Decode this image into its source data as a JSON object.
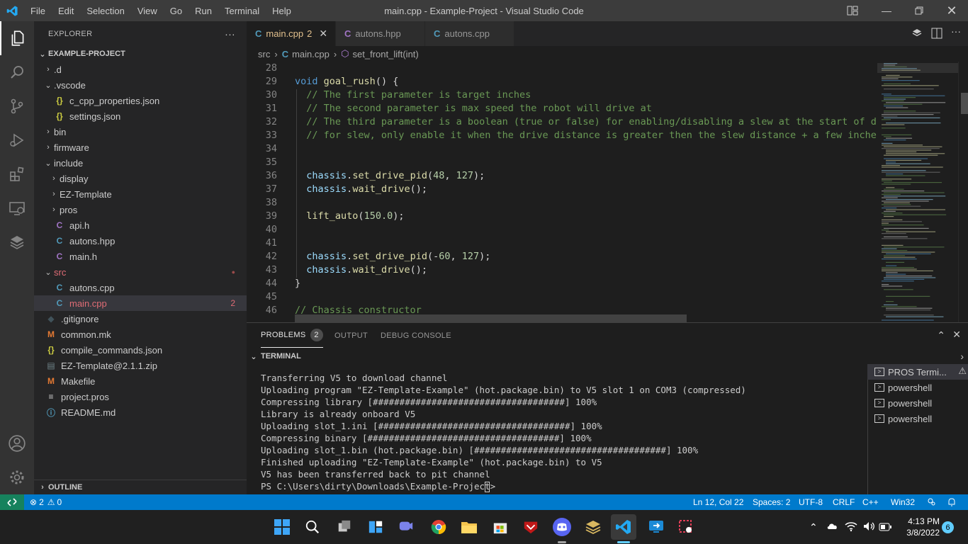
{
  "titlebar": {
    "menu": [
      "File",
      "Edit",
      "Selection",
      "View",
      "Go",
      "Run",
      "Terminal",
      "Help"
    ],
    "title": "main.cpp - Example-Project - Visual Studio Code"
  },
  "sidebar": {
    "header": "EXPLORER",
    "more": "···",
    "project": "EXAMPLE-PROJECT",
    "outline": "OUTLINE",
    "tree": [
      {
        "label": ".d",
        "kind": "folder-closed"
      },
      {
        "label": ".vscode",
        "kind": "folder-open"
      },
      {
        "label": "c_cpp_properties.json",
        "kind": "json"
      },
      {
        "label": "settings.json",
        "kind": "json"
      },
      {
        "label": "bin",
        "kind": "folder-closed"
      },
      {
        "label": "firmware",
        "kind": "folder-closed"
      },
      {
        "label": "include",
        "kind": "folder-open"
      },
      {
        "label": "display",
        "kind": "folder-closed"
      },
      {
        "label": "EZ-Template",
        "kind": "folder-closed"
      },
      {
        "label": "pros",
        "kind": "folder-closed"
      },
      {
        "label": "api.h",
        "kind": "c-header"
      },
      {
        "label": "autons.hpp",
        "kind": "cpp"
      },
      {
        "label": "main.h",
        "kind": "c-header"
      },
      {
        "label": "src",
        "kind": "folder-open-modified"
      },
      {
        "label": "autons.cpp",
        "kind": "cpp"
      },
      {
        "label": "main.cpp",
        "kind": "cpp-active",
        "badge": "2"
      },
      {
        "label": ".gitignore",
        "kind": "git"
      },
      {
        "label": "common.mk",
        "kind": "makefile"
      },
      {
        "label": "compile_commands.json",
        "kind": "json"
      },
      {
        "label": "EZ-Template@2.1.1.zip",
        "kind": "zip"
      },
      {
        "label": "Makefile",
        "kind": "makefile"
      },
      {
        "label": "project.pros",
        "kind": "text"
      },
      {
        "label": "README.md",
        "kind": "info"
      }
    ]
  },
  "tabs": [
    {
      "label": "main.cpp",
      "badge": "2",
      "active": true
    },
    {
      "label": "autons.hpp",
      "active": false
    },
    {
      "label": "autons.cpp",
      "active": false
    }
  ],
  "breadcrumb": {
    "folder": "src",
    "file": "main.cpp",
    "symbol": "set_front_lift(int)"
  },
  "code": [
    {
      "n": "28",
      "html": ""
    },
    {
      "n": "29",
      "html": "<span class=\"kw\">void</span> <span class=\"fn\">goal_rush</span>() {"
    },
    {
      "n": "30",
      "html": "  <span class=\"cm\">// The first parameter is target inches</span>"
    },
    {
      "n": "31",
      "html": "  <span class=\"cm\">// The second parameter is max speed the robot will drive at</span>"
    },
    {
      "n": "32",
      "html": "  <span class=\"cm\">// The third parameter is a boolean (true or false) for enabling/disabling a slew at the start of drive m</span>"
    },
    {
      "n": "33",
      "html": "  <span class=\"cm\">// for slew, only enable it when the drive distance is greater then the slew distance + a few inches</span>"
    },
    {
      "n": "34",
      "html": ""
    },
    {
      "n": "35",
      "html": ""
    },
    {
      "n": "36",
      "html": "  <span class=\"vr\">chassis</span>.<span class=\"fn\">set_drive_pid</span>(<span class=\"nm\">48</span>, <span class=\"nm\">127</span>);"
    },
    {
      "n": "37",
      "html": "  <span class=\"vr\">chassis</span>.<span class=\"fn\">wait_drive</span>();"
    },
    {
      "n": "38",
      "html": ""
    },
    {
      "n": "39",
      "html": "  <span class=\"fn\">lift_auto</span>(<span class=\"nm\">150.0</span>);"
    },
    {
      "n": "40",
      "html": ""
    },
    {
      "n": "41",
      "html": ""
    },
    {
      "n": "42",
      "html": "  <span class=\"vr\">chassis</span>.<span class=\"fn\">set_drive_pid</span>(-<span class=\"nm\">60</span>, <span class=\"nm\">127</span>);"
    },
    {
      "n": "43",
      "html": "  <span class=\"vr\">chassis</span>.<span class=\"fn\">wait_drive</span>();"
    },
    {
      "n": "44",
      "html": "}"
    },
    {
      "n": "45",
      "html": ""
    },
    {
      "n": "46",
      "html": "<span class=\"cm\">// Chassis constructor</span>"
    }
  ],
  "panel": {
    "tabs": [
      {
        "label": "PROBLEMS",
        "badge": "2",
        "active": true
      },
      {
        "label": "OUTPUT",
        "active": false
      },
      {
        "label": "DEBUG CONSOLE",
        "active": false
      }
    ],
    "terminal_header": "TERMINAL",
    "terminal_lines": [
      "Transferring V5 to download channel",
      "Uploading program \"EZ-Template-Example\" (hot.package.bin) to V5 slot 1 on COM3 (compressed)",
      "Compressing library [####################################] 100%",
      "Library is already onboard V5",
      "Uploading slot_1.ini [####################################] 100%",
      "Compressing binary [####################################] 100%",
      "Uploading slot_1.bin (hot.package.bin) [####################################] 100%",
      "Finished uploading \"EZ-Template-Example\" (hot.package.bin) to V5",
      "V5 has been transferred back to pit channel",
      "PS C:\\Users\\dirty\\Downloads\\Example-Project> "
    ],
    "terminals": [
      "PROS Termi...",
      "powershell",
      "powershell",
      "powershell"
    ]
  },
  "statusbar": {
    "errors": "2",
    "warnings": "0",
    "position": "Ln 12, Col 22",
    "spaces": "Spaces: 2",
    "encoding": "UTF-8",
    "eol": "CRLF",
    "language": "C++",
    "platform": "Win32"
  },
  "taskbar": {
    "time": "4:13 PM",
    "date": "3/8/2022",
    "notifications": "6"
  },
  "colors": {
    "accent": "#007acc",
    "modified": "#e2c08d",
    "error": "#e06c75"
  }
}
